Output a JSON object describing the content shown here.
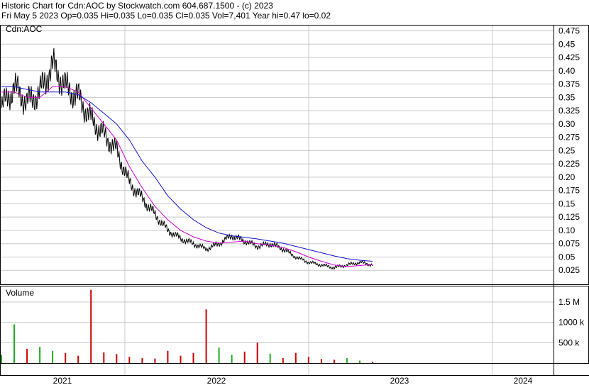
{
  "header": {
    "line1": "Historic Chart for Cdn:AOC by Stockwatch.com 604.687.1500 - (c) 2023",
    "line2": "Fri May  5 2023  Op=0.035  Hi=0.035  Lo=0.035  Cl=0.035  Vol=7,401  Year hi=0.47  lo=0.02"
  },
  "colors": {
    "up": "#22aa22",
    "down": "#cc0000",
    "price": "#000000",
    "ma_fast": "#cc00cc",
    "ma_slow": "#1010cc",
    "grid": "#c8c8c8",
    "frame": "#000000"
  },
  "chart_data": [
    {
      "type": "line",
      "panel": "price",
      "symbol": "Cdn:AOC",
      "ylim": [
        0,
        0.485
      ],
      "y_ticks": [
        "0.475",
        "0.45",
        "0.425",
        "0.40",
        "0.375",
        "0.35",
        "0.325",
        "0.30",
        "0.275",
        "0.25",
        "0.225",
        "0.20",
        "0.175",
        "0.15",
        "0.125",
        "0.10",
        "0.075",
        "0.05",
        "0.025"
      ],
      "x_ticks": [
        "2021",
        "2022",
        "2023",
        "2024"
      ],
      "grid": true,
      "x": [
        "2020-12",
        "2021-01",
        "2021-02",
        "2021-03",
        "2021-04",
        "2021-05",
        "2021-06",
        "2021-07",
        "2021-08",
        "2021-09",
        "2021-10",
        "2021-11",
        "2021-12",
        "2022-01",
        "2022-02",
        "2022-03",
        "2022-04",
        "2022-05",
        "2022-06",
        "2022-07",
        "2022-08",
        "2022-09",
        "2022-10",
        "2022-11",
        "2022-12",
        "2023-01",
        "2023-02",
        "2023-03",
        "2023-04",
        "2023-05"
      ],
      "series": [
        {
          "values": [
            0.33,
            0.37,
            0.34,
            0.36,
            0.41,
            0.37,
            0.35,
            0.31,
            0.28,
            0.25,
            0.19,
            0.16,
            0.13,
            0.1,
            0.085,
            0.075,
            0.065,
            0.075,
            0.09,
            0.08,
            0.07,
            0.075,
            0.065,
            0.05,
            0.04,
            0.035,
            0.03,
            0.035,
            0.04,
            0.035
          ]
        },
        {
          "values": [
            0.36,
            0.36,
            0.35,
            0.35,
            0.37,
            0.37,
            0.36,
            0.33,
            0.3,
            0.27,
            0.22,
            0.18,
            0.145,
            0.12,
            0.1,
            0.088,
            0.08,
            0.076,
            0.078,
            0.08,
            0.075,
            0.072,
            0.068,
            0.06,
            0.05,
            0.042,
            0.035,
            0.032,
            0.034,
            0.036
          ]
        },
        {
          "values": [
            0.37,
            0.37,
            0.365,
            0.36,
            0.36,
            0.36,
            0.355,
            0.34,
            0.32,
            0.3,
            0.27,
            0.23,
            0.2,
            0.165,
            0.14,
            0.12,
            0.105,
            0.095,
            0.09,
            0.087,
            0.084,
            0.08,
            0.076,
            0.07,
            0.064,
            0.058,
            0.052,
            0.047,
            0.044,
            0.042
          ]
        }
      ]
    },
    {
      "type": "bar",
      "panel": "volume",
      "title": "Volume",
      "ylim": [
        0,
        1900000
      ],
      "y_ticks": [
        "1.5 M",
        "1000 k",
        "500 k"
      ],
      "x": [
        "2020-12",
        "2021-01",
        "2021-02",
        "2021-03",
        "2021-04",
        "2021-05",
        "2021-06",
        "2021-07",
        "2021-08",
        "2021-09",
        "2021-10",
        "2021-11",
        "2021-12",
        "2022-01",
        "2022-02",
        "2022-03",
        "2022-04",
        "2022-05",
        "2022-06",
        "2022-07",
        "2022-08",
        "2022-09",
        "2022-10",
        "2022-11",
        "2022-12",
        "2023-01",
        "2023-02",
        "2023-03",
        "2023-04",
        "2023-05"
      ],
      "values": [
        200000,
        950000,
        350000,
        400000,
        300000,
        250000,
        180000,
        1800000,
        260000,
        220000,
        150000,
        120000,
        110000,
        300000,
        180000,
        250000,
        1320000,
        380000,
        200000,
        280000,
        500000,
        230000,
        120000,
        250000,
        150000,
        100000,
        80000,
        120000,
        60000,
        30000
      ]
    }
  ]
}
